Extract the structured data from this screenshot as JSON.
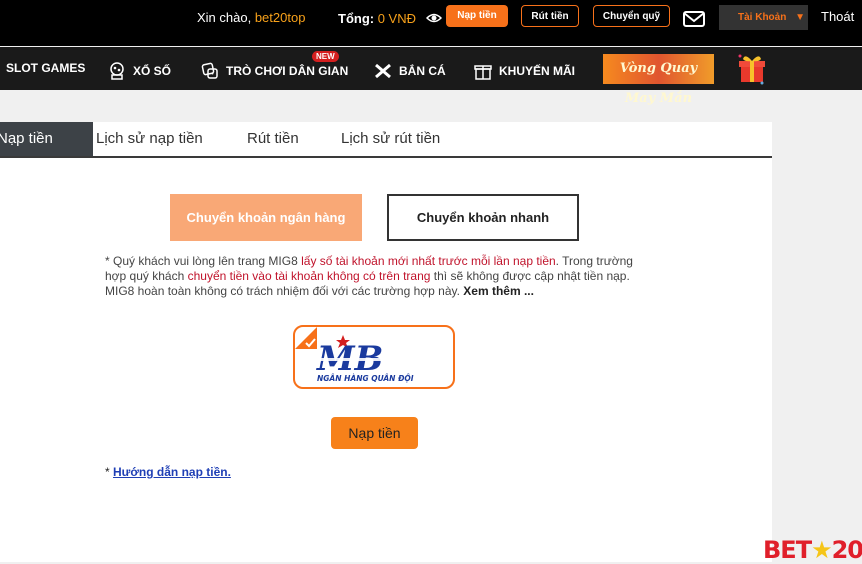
{
  "header": {
    "greeting": "Xin chào,",
    "username": "bet20top",
    "total_label": "Tổng:",
    "total_amount": "0 VNĐ",
    "deposit_btn": "Nạp tiền",
    "withdraw_btn": "Rút tiền",
    "transfer_btn": "Chuyển quỹ",
    "account_btn": "Tài Khoản",
    "logout": "Thoát"
  },
  "nav": {
    "items": [
      {
        "label": "SLOT GAMES"
      },
      {
        "label": "XỔ SỐ"
      },
      {
        "label": "TRÒ CHƠI DÂN GIAN"
      },
      {
        "label": "BẮN CÁ"
      },
      {
        "label": "KHUYẾN MÃI"
      }
    ],
    "new_badge": "NEW",
    "banner_text": "Vòng Quay May Mắn"
  },
  "tabs": [
    {
      "label": "Nạp tiền",
      "active": true
    },
    {
      "label": "Lịch sử nạp tiền"
    },
    {
      "label": "Rút tiền"
    },
    {
      "label": "Lịch sử rút tiền"
    }
  ],
  "methods": {
    "bank": "Chuyển khoản ngân hàng",
    "fast": "Chuyển khoản nhanh"
  },
  "notice": {
    "p1": "* Quý khách vui lòng lên trang MIG8 ",
    "r1": "lấy số tài khoản mới nhất trước mỗi lần nạp tiền",
    "p2": ". Trong trường hợp quý khách ",
    "r2": "chuyển tiền vào tài khoản không có trên trang",
    "p3": " thì sẽ không được cập nhật tiền nạp. MIG8 hoàn toàn không có trách nhiệm đối với các trường hợp này. ",
    "more": "Xem thêm ..."
  },
  "bank": {
    "name": "MB",
    "subtitle": "NGÂN HÀNG QUÂN ĐỘI"
  },
  "submit": "Nạp tiền",
  "guide": {
    "prefix": "* ",
    "link": "Hướng dẫn nạp tiền."
  },
  "brand": {
    "left": "BET",
    "right": "20"
  },
  "colors": {
    "accent": "#f7711a",
    "selected_method": "#f9a876",
    "notice_red": "#c0132b"
  }
}
